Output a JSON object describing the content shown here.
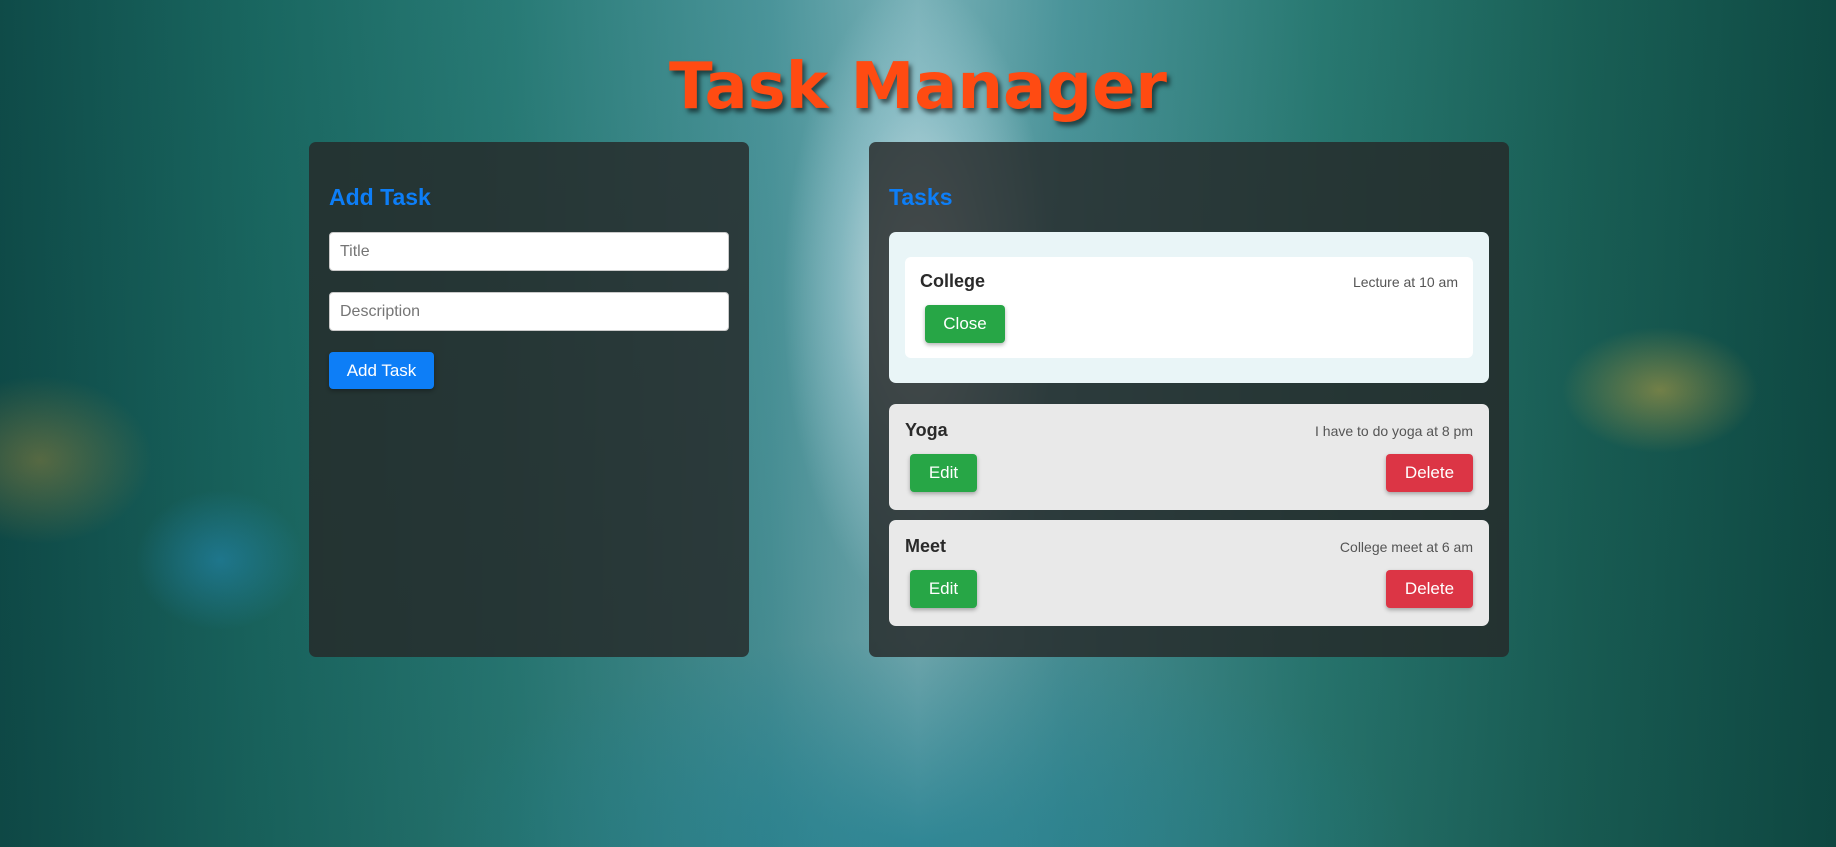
{
  "app": {
    "title": "Task Manager"
  },
  "add_panel": {
    "heading": "Add Task",
    "title_placeholder": "Title",
    "description_placeholder": "Description",
    "submit_label": "Add Task"
  },
  "tasks_panel": {
    "heading": "Tasks",
    "open_task": {
      "title": "College",
      "description": "Lecture at 10 am",
      "close_label": "Close"
    },
    "tasks": [
      {
        "title": "Yoga",
        "description": "I have to do yoga at 8 pm",
        "edit_label": "Edit",
        "delete_label": "Delete"
      },
      {
        "title": "Meet",
        "description": "College meet at 6 am",
        "edit_label": "Edit",
        "delete_label": "Delete"
      }
    ]
  },
  "colors": {
    "title": "#ff4b12",
    "heading": "#0d7ef7",
    "primary": "#0d7ef7",
    "success": "#27a646",
    "danger": "#dc3545"
  }
}
